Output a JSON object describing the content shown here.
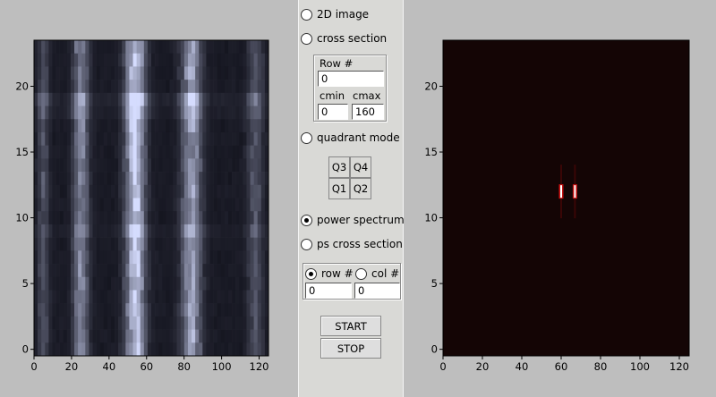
{
  "left_plot": {
    "x_ticks": [
      "0",
      "20",
      "40",
      "60",
      "80",
      "100",
      "120"
    ],
    "y_ticks": [
      "0",
      "5",
      "10",
      "15",
      "20"
    ],
    "x_range": [
      0,
      125
    ],
    "y_range": [
      -0.5,
      23.5
    ],
    "colormap": "bone",
    "colors": {
      "frame": "#000000",
      "dark": "#0d0d12",
      "light": "#e8f0f0"
    }
  },
  "right_plot": {
    "x_ticks": [
      "0",
      "20",
      "40",
      "60",
      "80",
      "100",
      "120"
    ],
    "y_ticks": [
      "0",
      "5",
      "10",
      "15",
      "20"
    ],
    "x_range": [
      0,
      125
    ],
    "y_range": [
      -0.5,
      23.5
    ],
    "colormap": "hot",
    "colors": {
      "background": "#140505",
      "peak": "#ffffff",
      "glow": "#c81010"
    },
    "peaks": [
      {
        "x": 60,
        "y": 12
      },
      {
        "x": 67,
        "y": 12
      }
    ]
  },
  "controls": {
    "mode_2d": {
      "label": "2D image",
      "selected": false
    },
    "mode_cross": {
      "label": "cross section",
      "selected": false
    },
    "row_label": "Row #",
    "row_value": "0",
    "cmin_label": "cmin",
    "cmin_value": "0",
    "cmax_label": "cmax",
    "cmax_value": "160",
    "mode_quadrant": {
      "label": "quadrant mode",
      "selected": false
    },
    "quadrants": {
      "q3": "Q3",
      "q4": "Q4",
      "q1": "Q1",
      "q2": "Q2"
    },
    "mode_power": {
      "label": "power spectrum",
      "selected": true
    },
    "mode_ps_cross": {
      "label": "ps cross section",
      "selected": false
    },
    "row_radio": {
      "label": "row #",
      "selected": true
    },
    "col_radio": {
      "label": "col #",
      "selected": false
    },
    "row_num_value": "0",
    "col_num_value": "0",
    "start_label": "START",
    "stop_label": "STOP"
  }
}
